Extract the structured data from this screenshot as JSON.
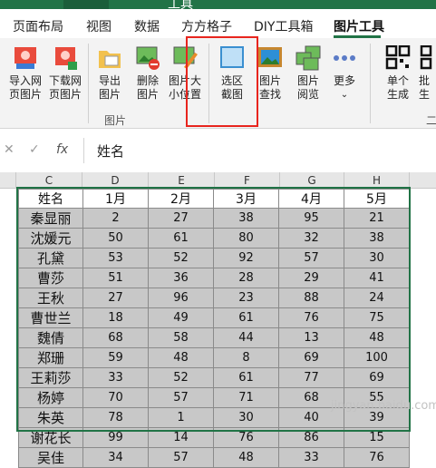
{
  "titlebar": {
    "title": "工具"
  },
  "tabs": [
    {
      "label": "页面布局"
    },
    {
      "label": "视图"
    },
    {
      "label": "数据"
    },
    {
      "label": "方方格子"
    },
    {
      "label": "DIY工具箱"
    },
    {
      "label": "图片工具",
      "active": true
    }
  ],
  "ribbon": {
    "buttons": [
      {
        "label1": "导入网",
        "label2": "页图片"
      },
      {
        "label1": "下载网",
        "label2": "页图片"
      },
      {
        "label1": "导出",
        "label2": "图片"
      },
      {
        "label1": "删除",
        "label2": "图片"
      },
      {
        "label1": "图片大",
        "label2": "小位置"
      },
      {
        "label1": "选区",
        "label2": "截图"
      },
      {
        "label1": "图片",
        "label2": "查找"
      },
      {
        "label1": "图片",
        "label2": "阅览"
      },
      {
        "label1": "更多",
        "label2": "⌄"
      },
      {
        "label1": "单个",
        "label2": "生成"
      },
      {
        "label1": "批",
        "label2": "生"
      }
    ],
    "group_label": "图片",
    "group_label2": "二"
  },
  "formula_bar": {
    "cancel": "✕",
    "confirm": "✓",
    "fx": "fx",
    "value": "姓名"
  },
  "columns": [
    "C",
    "D",
    "E",
    "F",
    "G",
    "H"
  ],
  "table": {
    "headers": [
      "姓名",
      "1月",
      "2月",
      "3月",
      "4月",
      "5月"
    ],
    "rows": [
      [
        "秦显丽",
        "2",
        "27",
        "38",
        "95",
        "21"
      ],
      [
        "沈媛元",
        "50",
        "61",
        "80",
        "32",
        "38"
      ],
      [
        "孔黛",
        "53",
        "52",
        "92",
        "57",
        "30"
      ],
      [
        "曹莎",
        "51",
        "36",
        "28",
        "29",
        "41"
      ],
      [
        "王秋",
        "27",
        "96",
        "23",
        "88",
        "24"
      ],
      [
        "曹世兰",
        "18",
        "49",
        "61",
        "76",
        "75"
      ],
      [
        "魏倩",
        "68",
        "58",
        "44",
        "13",
        "48"
      ],
      [
        "郑珊",
        "59",
        "48",
        "8",
        "69",
        "100"
      ],
      [
        "王莉莎",
        "33",
        "52",
        "61",
        "77",
        "69"
      ],
      [
        "杨婷",
        "70",
        "57",
        "71",
        "68",
        "55"
      ],
      [
        "朱英",
        "78",
        "1",
        "30",
        "40",
        "39"
      ],
      [
        "谢花长",
        "99",
        "14",
        "76",
        "86",
        "15"
      ],
      [
        "吴佳",
        "34",
        "57",
        "48",
        "33",
        "76"
      ]
    ]
  },
  "colors": {
    "accent": "#217346",
    "highlight_box": "#e8251e",
    "cell_fill": "#c8c8c8"
  },
  "watermark": "jingyan.baidu.com"
}
